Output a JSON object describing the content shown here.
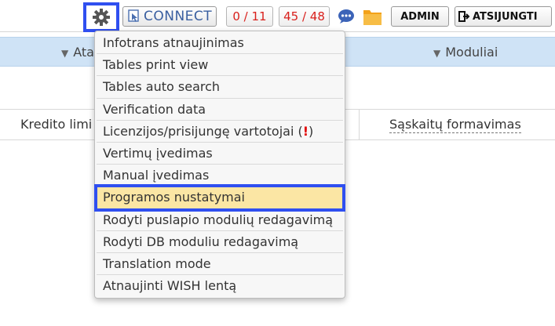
{
  "topbar": {
    "connect_label": "CONNECT",
    "counter_a": "0 / 11",
    "counter_b": "45 / 48",
    "admin_label": "ADMIN",
    "logout_label": "ATSIJUNGTI"
  },
  "nav": {
    "left_label": "Ata",
    "right_label": "Moduliai"
  },
  "band2": {
    "left_label": "Kredito limi",
    "right_label": "Sąskaitų formavimas"
  },
  "menu": {
    "items": [
      {
        "label": "Infotrans atnaujinimas"
      },
      {
        "label": "Tables print view"
      },
      {
        "label": "Tables auto search"
      },
      {
        "label": "Verification data"
      },
      {
        "label": "Licenzijos/prisijungę vartotojai",
        "warn_open": "(",
        "warn_mark": "!",
        "warn_close": ")"
      },
      {
        "label": "Vertimų įvedimas"
      },
      {
        "label": "Manual įvedimas"
      },
      {
        "label": "Programos nustatymai"
      },
      {
        "label": "Rodyti puslapio modulių redagavimą"
      },
      {
        "label": "Rodyti DB moduliu redagavimą"
      },
      {
        "label": "Translation mode"
      },
      {
        "label": "Atnaujinti WISH lentą"
      }
    ]
  },
  "icons": {
    "gear": "gear-icon",
    "connect": "cursor-window-icon",
    "chat": "chat-bubble-icon",
    "folder": "folder-icon",
    "logout": "logout-icon",
    "nav_caret": "triangle-down-icon"
  },
  "colors": {
    "highlight_border": "#2f4ff0",
    "highlight_fill": "#fbe6a4",
    "counter_text": "#d9201c",
    "nav_band": "#cfe3f6",
    "warning": "#e10000"
  }
}
